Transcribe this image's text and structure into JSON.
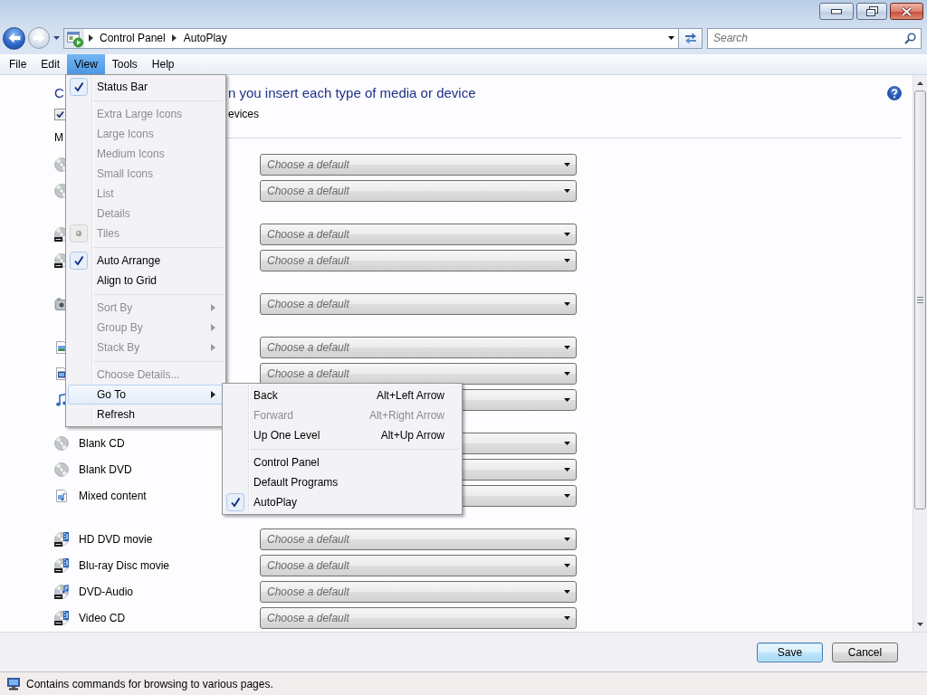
{
  "nav_buttons": [
    {
      "kind": "back",
      "disabled": false
    },
    {
      "kind": "forward",
      "disabled": true
    }
  ],
  "address_bar": {
    "crumbs": [
      "Control Panel",
      "AutoPlay"
    ]
  },
  "search": {
    "placeholder": "Search"
  },
  "menu_bar": [
    {
      "label": "File",
      "selected": false
    },
    {
      "label": "Edit",
      "selected": false
    },
    {
      "label": "View",
      "selected": true
    },
    {
      "label": "Tools",
      "selected": false
    },
    {
      "label": "Help",
      "selected": false
    }
  ],
  "view_menu": {
    "items": [
      {
        "kind": "check",
        "label": "Status Bar",
        "checked": true,
        "disabled": false
      },
      {
        "kind": "separator"
      },
      {
        "kind": "radio",
        "label": "Extra Large Icons",
        "selected": false,
        "disabled": true
      },
      {
        "kind": "radio",
        "label": "Large Icons",
        "selected": false,
        "disabled": true
      },
      {
        "kind": "radio",
        "label": "Medium Icons",
        "selected": false,
        "disabled": true
      },
      {
        "kind": "radio",
        "label": "Small Icons",
        "selected": false,
        "disabled": true
      },
      {
        "kind": "radio",
        "label": "List",
        "selected": false,
        "disabled": true
      },
      {
        "kind": "radio",
        "label": "Details",
        "selected": false,
        "disabled": true
      },
      {
        "kind": "radio",
        "label": "Tiles",
        "selected": true,
        "disabled": true
      },
      {
        "kind": "separator"
      },
      {
        "kind": "check",
        "label": "Auto Arrange",
        "checked": true,
        "disabled": false
      },
      {
        "kind": "check",
        "label": "Align to Grid",
        "checked": false,
        "disabled": false
      },
      {
        "kind": "separator"
      },
      {
        "kind": "submenu",
        "label": "Sort By",
        "expanded": false,
        "disabled": true
      },
      {
        "kind": "submenu",
        "label": "Group By",
        "expanded": false,
        "disabled": true
      },
      {
        "kind": "submenu",
        "label": "Stack By",
        "expanded": false,
        "disabled": true
      },
      {
        "kind": "separator"
      },
      {
        "kind": "command",
        "label": "Choose Details...",
        "disabled": true
      },
      {
        "kind": "submenu",
        "label": "Go To",
        "expanded": true,
        "disabled": false,
        "submenu": {
          "items": [
            {
              "kind": "command",
              "label": "Back",
              "shortcut": "Alt+Left Arrow",
              "disabled": false
            },
            {
              "kind": "command",
              "label": "Forward",
              "shortcut": "Alt+Right Arrow",
              "disabled": true
            },
            {
              "kind": "command",
              "label": "Up One Level",
              "shortcut": "Alt+Up Arrow",
              "disabled": false
            },
            {
              "kind": "separator"
            },
            {
              "kind": "check",
              "label": "Control Panel",
              "checked": false,
              "disabled": false
            },
            {
              "kind": "check",
              "label": "Default Programs",
              "checked": false,
              "disabled": false
            },
            {
              "kind": "check",
              "label": "AutoPlay",
              "checked": true,
              "disabled": false
            }
          ]
        }
      },
      {
        "kind": "command",
        "label": "Refresh",
        "disabled": false
      }
    ]
  },
  "content": {
    "heading_fragments": [
      "C",
      "n you insert each type of media or device"
    ],
    "checkbox": {
      "label": "evices",
      "checked": true
    },
    "section_label": "M",
    "groups": [
      {
        "rows": [
          {
            "kind": "disc",
            "value": "Choose a default"
          },
          {
            "kind": "disc",
            "value": "Choose a default"
          }
        ]
      },
      {
        "rows": [
          {
            "kind": "labeled_disc",
            "value": "Choose a default"
          },
          {
            "kind": "labeled_disc",
            "value": "Choose a default"
          }
        ]
      },
      {
        "rows": [
          {
            "kind": "camera",
            "value": "Choose a default"
          }
        ]
      },
      {
        "rows": [
          {
            "kind": "picture_file",
            "value": "Choose a default"
          },
          {
            "kind": "video_file",
            "value": "Choose a default"
          },
          {
            "kind": "music_file"
          }
        ]
      },
      {
        "rows": [
          {
            "kind": "disc",
            "label": "Blank CD"
          },
          {
            "kind": "disc",
            "label": "Blank DVD"
          },
          {
            "kind": "media_file",
            "label": "Mixed content"
          }
        ]
      },
      {
        "rows": [
          {
            "kind": "film_disc",
            "label": "HD DVD movie",
            "value": "Choose a default"
          },
          {
            "kind": "film_disc",
            "label": "Blu-ray Disc movie",
            "value": "Choose a default"
          },
          {
            "kind": "music_disc",
            "label": "DVD-Audio",
            "value": "Choose a default"
          },
          {
            "kind": "film_disc",
            "label": "Video CD",
            "value": "Choose a default"
          }
        ]
      }
    ]
  },
  "footer_buttons": [
    {
      "label": "Save",
      "default": true
    },
    {
      "label": "Cancel",
      "default": false
    }
  ],
  "status_bar": {
    "text": "Contains commands for browsing to various pages."
  }
}
